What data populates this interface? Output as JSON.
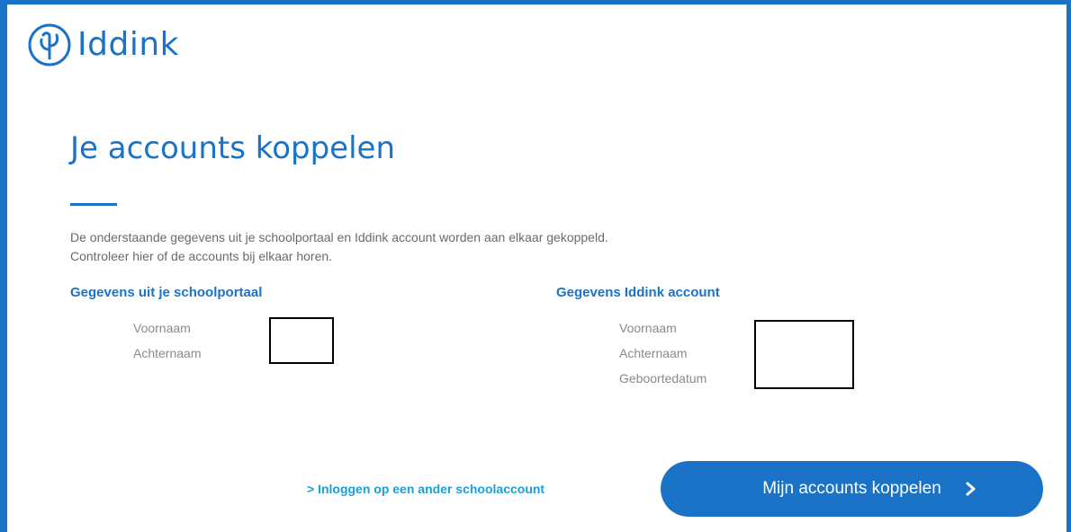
{
  "brand": {
    "name": "Iddink",
    "color": "#1a73c6"
  },
  "page": {
    "title": "Je accounts koppelen",
    "intro": "De onderstaande gegevens uit je schoolportaal en Iddink account worden aan elkaar gekoppeld. Controleer hier of de accounts bij elkaar horen."
  },
  "schoolportal": {
    "heading": "Gegevens uit je schoolportaal",
    "fields": [
      "Voornaam",
      "Achternaam"
    ]
  },
  "iddink_account": {
    "heading": "Gegevens Iddink account",
    "fields": [
      "Voornaam",
      "Achternaam",
      "Geboortedatum"
    ]
  },
  "actions": {
    "alt_link": "> Inloggen op een ander schoolaccount",
    "primary_button": "Mijn accounts koppelen",
    "primary_icon": "chevron-right-icon"
  }
}
